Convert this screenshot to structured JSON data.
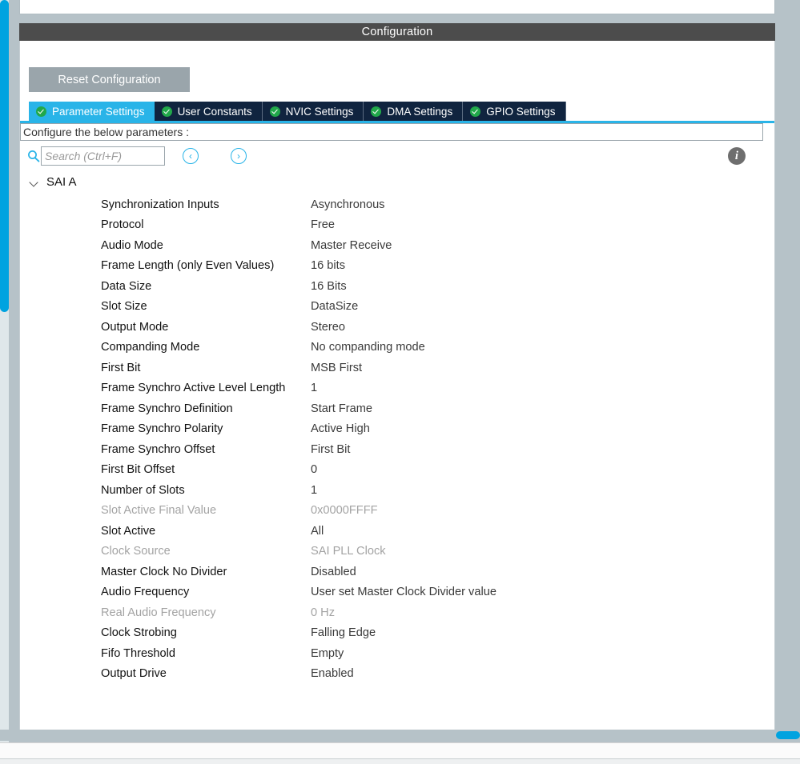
{
  "window": {
    "title": "Configuration"
  },
  "toolbar": {
    "reset_label": "Reset Configuration"
  },
  "tabs": [
    {
      "label": "Parameter Settings",
      "icon": "check-circle-icon",
      "active": true
    },
    {
      "label": "User Constants",
      "icon": "check-circle-icon",
      "active": false
    },
    {
      "label": "NVIC Settings",
      "icon": "check-circle-icon",
      "active": false
    },
    {
      "label": "DMA Settings",
      "icon": "check-circle-icon",
      "active": false
    },
    {
      "label": "GPIO Settings",
      "icon": "check-circle-icon",
      "active": false
    }
  ],
  "hint": {
    "text": "Configure the below parameters :"
  },
  "search": {
    "placeholder": "Search (Ctrl+F)",
    "value": "",
    "prev_glyph": "‹",
    "next_glyph": "›",
    "info_glyph": "i"
  },
  "tree": {
    "group_label": "SAI A",
    "expanded": true
  },
  "parameters": [
    {
      "name": "Synchronization Inputs",
      "value": "Asynchronous",
      "disabled": false
    },
    {
      "name": "Protocol",
      "value": "Free",
      "disabled": false
    },
    {
      "name": "Audio Mode",
      "value": "Master Receive",
      "disabled": false
    },
    {
      "name": "Frame Length (only Even Values)",
      "value": "16 bits",
      "disabled": false
    },
    {
      "name": "Data Size",
      "value": "16 Bits",
      "disabled": false
    },
    {
      "name": "Slot Size",
      "value": "DataSize",
      "disabled": false
    },
    {
      "name": "Output Mode",
      "value": "Stereo",
      "disabled": false
    },
    {
      "name": "Companding Mode",
      "value": "No companding mode",
      "disabled": false
    },
    {
      "name": "First Bit",
      "value": "MSB First",
      "disabled": false
    },
    {
      "name": "Frame Synchro Active Level Length",
      "value": "1",
      "disabled": false
    },
    {
      "name": "Frame Synchro Definition",
      "value": "Start Frame",
      "disabled": false
    },
    {
      "name": "Frame Synchro Polarity",
      "value": "Active High",
      "disabled": false
    },
    {
      "name": "Frame Synchro Offset",
      "value": "First Bit",
      "disabled": false
    },
    {
      "name": "First Bit Offset",
      "value": "0",
      "disabled": false
    },
    {
      "name": "Number of Slots",
      "value": "1",
      "disabled": false
    },
    {
      "name": "Slot Active Final Value",
      "value": "0x0000FFFF",
      "disabled": true
    },
    {
      "name": "Slot Active",
      "value": "All",
      "disabled": false
    },
    {
      "name": "Clock Source",
      "value": "SAI PLL Clock",
      "disabled": true
    },
    {
      "name": "Master Clock No Divider",
      "value": "Disabled",
      "disabled": false
    },
    {
      "name": "Audio Frequency",
      "value": "User set Master Clock Divider value",
      "disabled": false
    },
    {
      "name": "Real Audio Frequency",
      "value": "0 Hz",
      "disabled": true
    },
    {
      "name": "Clock Strobing",
      "value": "Falling Edge",
      "disabled": false
    },
    {
      "name": "Fifo Threshold",
      "value": "Empty",
      "disabled": false
    },
    {
      "name": "Output Drive",
      "value": "Enabled",
      "disabled": false
    }
  ],
  "colors": {
    "accent_cyan": "#29b4e8",
    "scrollbar_cyan": "#00a3e0",
    "tab_inactive": "#10243f",
    "titlebar": "#4c4c4c",
    "button_gray": "#9aa5ab",
    "check_green": "#21a84a",
    "disabled_text": "#a3a3a3"
  }
}
